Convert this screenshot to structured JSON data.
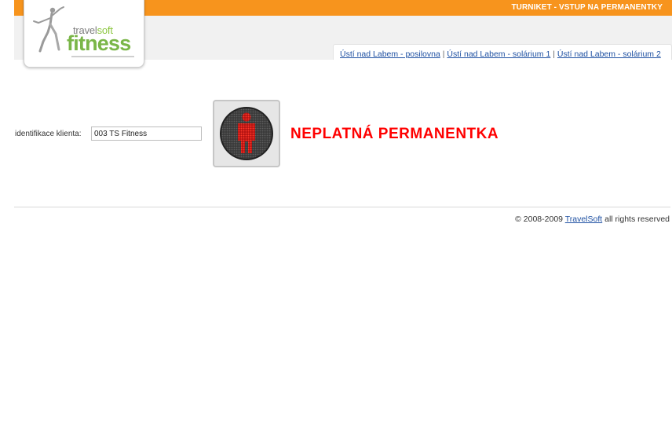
{
  "header": {
    "title": "TURNIKET - VSTUP NA PERMANENTKY",
    "accent_color": "#f7941d"
  },
  "logo": {
    "travel": "travel",
    "soft": "soft",
    "fitness": "fitness"
  },
  "tabs": [
    {
      "label": "Ústí nad Labem - posilovna"
    },
    {
      "label": "Ústí nad Labem - solárium 1"
    },
    {
      "label": "Ústí nad Labem - solárium 2"
    }
  ],
  "client": {
    "label": "identifikace klienta:",
    "value": "003 TS Fitness"
  },
  "status": {
    "icon": "red-man-stop-signal-icon",
    "text": "NEPLATNÁ PERMANENTKA",
    "color": "#ff0000"
  },
  "footer": {
    "copyright": "© 2008-2009",
    "link": "TravelSoft",
    "rights": "all rights reserved"
  }
}
